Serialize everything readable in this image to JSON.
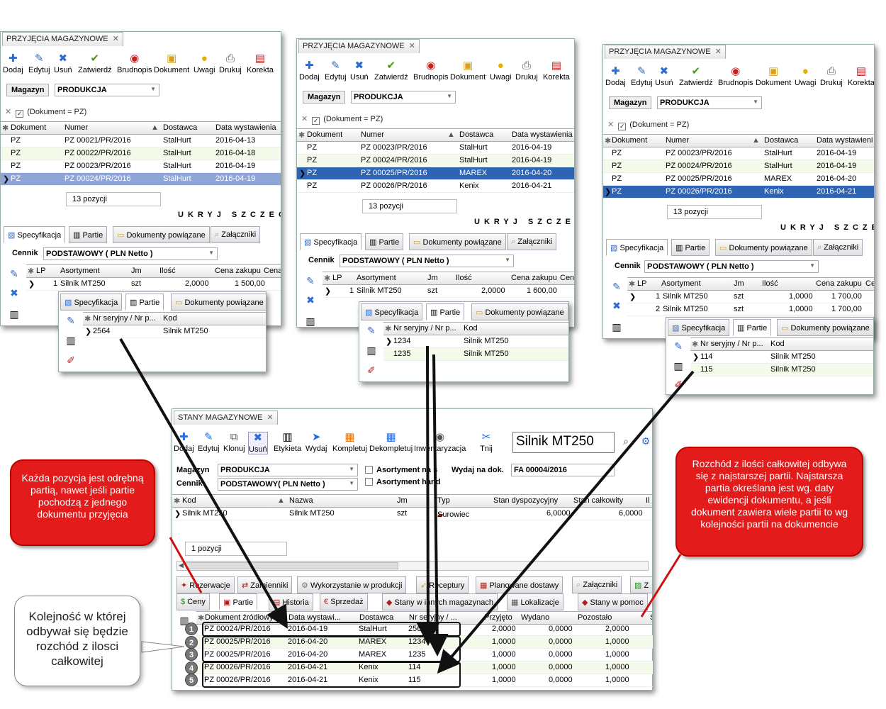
{
  "w1": {
    "tab": "PRZYJĘCIA MAGAZYNOWE",
    "toolbar": [
      "Dodaj",
      "Edytuj",
      "Usuń",
      "Zatwierdź",
      "Brudnopis",
      "Dokument",
      "Uwagi",
      "Drukuj",
      "Korekta"
    ],
    "magazyn_label": "Magazyn",
    "magazyn_value": "PRODUKCJA",
    "filter": "(Dokument = PZ)",
    "cols": [
      "Dokument",
      "Numer",
      "Dostawca",
      "Data wystawienia"
    ],
    "rows": [
      [
        "PZ",
        "PZ 00021/PR/2016",
        "StalHurt",
        "2016-04-13"
      ],
      [
        "PZ",
        "PZ 00022/PR/2016",
        "StalHurt",
        "2016-04-18"
      ],
      [
        "PZ",
        "PZ 00023/PR/2016",
        "StalHurt",
        "2016-04-19"
      ],
      [
        "PZ",
        "PZ 00024/PR/2016",
        "StalHurt",
        "2016-04-19"
      ]
    ],
    "count": "13 pozycji",
    "ukryj": "UKRYJ SZCZEGÓ",
    "tabs": [
      "Specyfikacja",
      "Partie",
      "Dokumenty powiązane",
      "Załączniki"
    ],
    "cennik_label": "Cennik",
    "cennik_value": "PODSTAWOWY ( PLN Netto )",
    "spec_cols": [
      "LP",
      "Asortyment",
      "Jm",
      "Ilość",
      "Cena zakupu",
      "Cena"
    ],
    "spec_rows": [
      [
        "1",
        "Silnik MT250",
        "szt",
        "2,0000",
        "1 500,00"
      ]
    ],
    "sub_tabs": [
      "Specyfikacja",
      "Partie",
      "Dokumenty powiązane"
    ],
    "sub_cols": [
      "Nr seryjny / Nr p...",
      "Kod"
    ],
    "sub_rows": [
      [
        "2564",
        "Silnik MT250"
      ]
    ]
  },
  "w2": {
    "tab": "PRZYJĘCIA MAGAZYNOWE",
    "toolbar": [
      "Dodaj",
      "Edytuj",
      "Usuń",
      "Zatwierdź",
      "Brudnopis",
      "Dokument",
      "Uwagi",
      "Drukuj",
      "Korekta"
    ],
    "magazyn_label": "Magazyn",
    "magazyn_value": "PRODUKCJA",
    "filter": "(Dokument = PZ)",
    "cols": [
      "Dokument",
      "Numer",
      "Dostawca",
      "Data wystawienia"
    ],
    "rows": [
      [
        "PZ",
        "PZ 00023/PR/2016",
        "StalHurt",
        "2016-04-19"
      ],
      [
        "PZ",
        "PZ 00024/PR/2016",
        "StalHurt",
        "2016-04-19"
      ],
      [
        "PZ",
        "PZ 00025/PR/2016",
        "MAREX",
        "2016-04-20"
      ],
      [
        "PZ",
        "PZ 00026/PR/2016",
        "Kenix",
        "2016-04-21"
      ]
    ],
    "count": "13 pozycji",
    "ukryj": "UKRYJ SZCZEGÓ",
    "tabs": [
      "Specyfikacja",
      "Partie",
      "Dokumenty powiązane",
      "Załączniki"
    ],
    "cennik_label": "Cennik",
    "cennik_value": "PODSTAWOWY ( PLN Netto )",
    "spec_cols": [
      "LP",
      "Asortyment",
      "Jm",
      "Ilość",
      "Cena zakupu",
      "Cena"
    ],
    "spec_rows": [
      [
        "1",
        "Silnik MT250",
        "szt",
        "2,0000",
        "1 600,00"
      ]
    ],
    "sub_tabs": [
      "Specyfikacja",
      "Partie",
      "Dokumenty powiązane"
    ],
    "sub_cols": [
      "Nr seryjny / Nr p...",
      "Kod"
    ],
    "sub_rows": [
      [
        "1234",
        "Silnik MT250"
      ],
      [
        "1235",
        "Silnik MT250"
      ]
    ]
  },
  "w3": {
    "tab": "PRZYJĘCIA MAGAZYNOWE",
    "toolbar": [
      "Dodaj",
      "Edytuj",
      "Usuń",
      "Zatwierdź",
      "Brudnopis",
      "Dokument",
      "Uwagi",
      "Drukuj",
      "Korekta"
    ],
    "magazyn_label": "Magazyn",
    "magazyn_value": "PRODUKCJA",
    "filter": "(Dokument = PZ)",
    "cols": [
      "Dokument",
      "Numer",
      "Dostawca",
      "Data wystawieni"
    ],
    "rows": [
      [
        "PZ",
        "PZ 00023/PR/2016",
        "StalHurt",
        "2016-04-19"
      ],
      [
        "PZ",
        "PZ 00024/PR/2016",
        "StalHurt",
        "2016-04-19"
      ],
      [
        "PZ",
        "PZ 00025/PR/2016",
        "MAREX",
        "2016-04-20"
      ],
      [
        "PZ",
        "PZ 00026/PR/2016",
        "Kenix",
        "2016-04-21"
      ]
    ],
    "count": "13 pozycji",
    "ukryj": "UKRYJ SZCZEG",
    "tabs": [
      "Specyfikacja",
      "Partie",
      "Dokumenty powiązane",
      "Załączniki"
    ],
    "cennik_label": "Cennik",
    "cennik_value": "PODSTAWOWY ( PLN Netto )",
    "spec_cols": [
      "LP",
      "Asortyment",
      "Jm",
      "Ilość",
      "Cena zakupu",
      "Cen"
    ],
    "spec_rows": [
      [
        "1",
        "Silnik MT250",
        "szt",
        "1,0000",
        "1 700,00"
      ],
      [
        "2",
        "Silnik MT250",
        "szt",
        "1,0000",
        "1 700,00"
      ]
    ],
    "sub_tabs": [
      "Specyfikacja",
      "Partie",
      "Dokumenty powiązane"
    ],
    "sub_cols": [
      "Nr seryjny / Nr p...",
      "Kod"
    ],
    "sub_rows": [
      [
        "114",
        "Silnik MT250"
      ],
      [
        "115",
        "Silnik MT250"
      ]
    ]
  },
  "main": {
    "tab": "STANY MAGAZYNOWE",
    "toolbar": [
      "Dodaj",
      "Edytuj",
      "Klonuj",
      "Usuń",
      "Etykieta",
      "Wydaj",
      "Kompletuj",
      "Dekompletuj",
      "Inwentaryzacja",
      "Tnij"
    ],
    "search_value": "Silnik MT250",
    "magazyn_label": "Magazyn",
    "magazyn_value": "PRODUKCJA",
    "cennik_label": "Cennik",
    "cennik_value": "PODSTAWOWY( PLN Netto )",
    "chk1": "Asortyment na s",
    "chk2": "Asortyment hand",
    "wydaj_label": "Wydaj na dok.",
    "wydaj_value": "FA 00004/2016",
    "cols": [
      "Kod",
      "Nazwa",
      "Jm",
      "Typ",
      "Stan dyspozycyjny",
      "Stan całkowity",
      "Il"
    ],
    "row": [
      "Silnik MT250",
      "Silnik MT250",
      "szt",
      "Surowiec",
      "6,0000",
      "6,0000"
    ],
    "count": "1 pozycji",
    "tabs1": [
      "Rezerwacje",
      "Zamienniki",
      "Wykorzystanie w produkcji",
      "Receptury",
      "Planowane dostawy",
      "Załączniki",
      "Z"
    ],
    "tabs2": [
      "Ceny",
      "Partie",
      "Historia",
      "Sprzedaż",
      "Stany w innych magazynach",
      "Lokalizacje",
      "Stany w pomoc"
    ],
    "pcols": [
      "Dokument źródłowy",
      "Data wystawi...",
      "Dostawca",
      "Nr seryjny / ...",
      "Przyjęto",
      "Wydano",
      "Pozostało",
      "S"
    ],
    "prows": [
      [
        "1",
        "PZ 00024/PR/2016",
        "2016-04-19",
        "StalHurt",
        "2564",
        "2,0000",
        "0,0000",
        "2,0000"
      ],
      [
        "2",
        "PZ 00025/PR/2016",
        "2016-04-20",
        "MAREX",
        "1234",
        "1,0000",
        "0,0000",
        "1,0000"
      ],
      [
        "3",
        "PZ 00025/PR/2016",
        "2016-04-20",
        "MAREX",
        "1235",
        "1,0000",
        "0,0000",
        "1,0000"
      ],
      [
        "4",
        "PZ 00026/PR/2016",
        "2016-04-21",
        "Kenix",
        "114",
        "1,0000",
        "0,0000",
        "1,0000"
      ],
      [
        "5",
        "PZ 00026/PR/2016",
        "2016-04-21",
        "Kenix",
        "115",
        "1,0000",
        "0,0000",
        "1,0000"
      ]
    ]
  },
  "callouts": {
    "left": "Każda pozycja jest odrębną partią, nawet jeśli partie pochodzą z jednego dokumentu przyjęcia",
    "right": "Rozchód z ilości całkowitej odbywa się z najstarszej partii. Najstarsza partia określana jest wg. daty ewidencji dokumentu, a jeśli dokument zawiera wiele partii to wg kolejności partii na dokumencie",
    "bottom": "Kolejność w której odbywał się będzie rozchód z ilosci całkowitej"
  },
  "colors": {
    "selected_light": "#8fa5d8",
    "selected_dark": "#2f64b4",
    "callout_red": "#e31b1b"
  }
}
